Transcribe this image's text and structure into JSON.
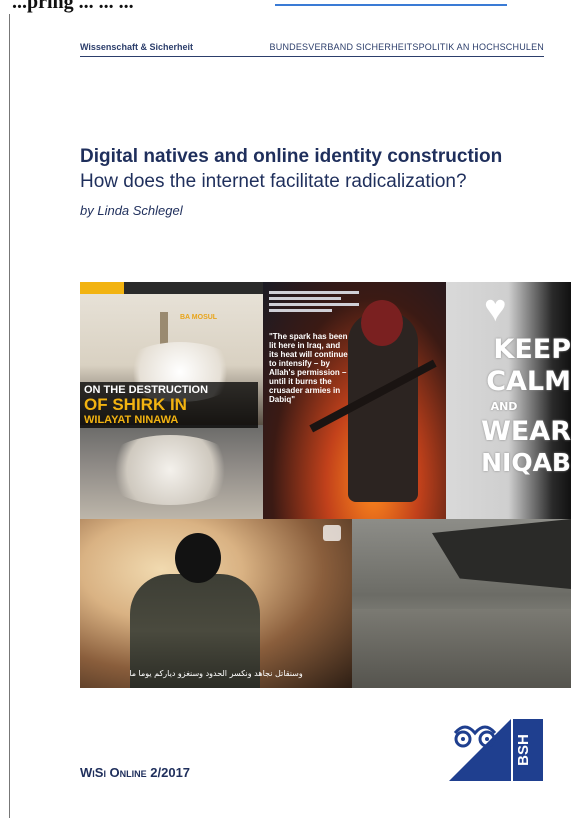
{
  "top_fragment": "...pring ... ... ...",
  "header": {
    "left": "Wissenschaft & Sicherheit",
    "right": "BUNDESVERBAND SICHERHEITSPOLITIK AN HOCHSCHULEN"
  },
  "title": "Digital natives and online identity construction",
  "subtitle": "How does the internet facilitate radicalization?",
  "author": "by Linda Schlegel",
  "collage": {
    "panel1": {
      "tag": "BA MOSUL",
      "caption_line1": "ON THE DESTRUCTION",
      "caption_line2": "OF SHIRK IN",
      "caption_line3": "WILAYAT NINAWA"
    },
    "panel2": {
      "quote": "\"The spark has been lit here in Iraq, and its heat will continue to intensify – by Allah's permission – until it burns the crusader armies in Dabiq\""
    },
    "panel3": {
      "heart": "♥",
      "word1": "KEEP",
      "word2": "CALM",
      "word3": "AND",
      "word4": "WEAR",
      "word5": "NIQAB"
    },
    "panel4": {
      "subtitle": "وسنقاتل نجاهد ونكسر الحدود وسنغزو دياركم يوما ما"
    }
  },
  "footer": "WiSi Online 2/2017",
  "logo": {
    "text": "BSH"
  }
}
